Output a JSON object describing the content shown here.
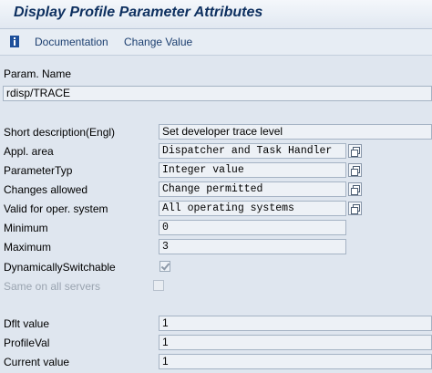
{
  "window": {
    "title": "Display Profile Parameter Attributes"
  },
  "toolbar": {
    "info_icon": "info-icon",
    "documentation_label": "Documentation",
    "change_value_label": "Change Value"
  },
  "param": {
    "name_label": "Param. Name",
    "name_value": "rdisp/TRACE"
  },
  "attributes": {
    "short_description": {
      "label": "Short description(Engl)",
      "value": "Set developer trace level"
    },
    "appl_area": {
      "label": "Appl. area",
      "value": "Dispatcher and Task Handler"
    },
    "parameter_type": {
      "label": "ParameterTyp",
      "value": "Integer value"
    },
    "changes_allowed": {
      "label": "Changes allowed",
      "value": "Change permitted"
    },
    "valid_for_os": {
      "label": "Valid for oper. system",
      "value": "All operating systems"
    },
    "minimum": {
      "label": "Minimum",
      "value": "0"
    },
    "maximum": {
      "label": "Maximum",
      "value": "3"
    },
    "dynamically_switchable": {
      "label": "DynamicallySwitchable",
      "checked": true
    },
    "same_on_all_servers": {
      "label": "Same on all servers",
      "checked": false
    }
  },
  "values": {
    "default": {
      "label": "Dflt value",
      "value": "1"
    },
    "profile": {
      "label": "ProfileVal",
      "value": "1"
    },
    "current": {
      "label": "Current value",
      "value": "1"
    }
  },
  "colors": {
    "title": "#0d2f5f",
    "background": "#dfe6ef",
    "field_background": "#edf1f6",
    "link": "#1b3e6f"
  }
}
